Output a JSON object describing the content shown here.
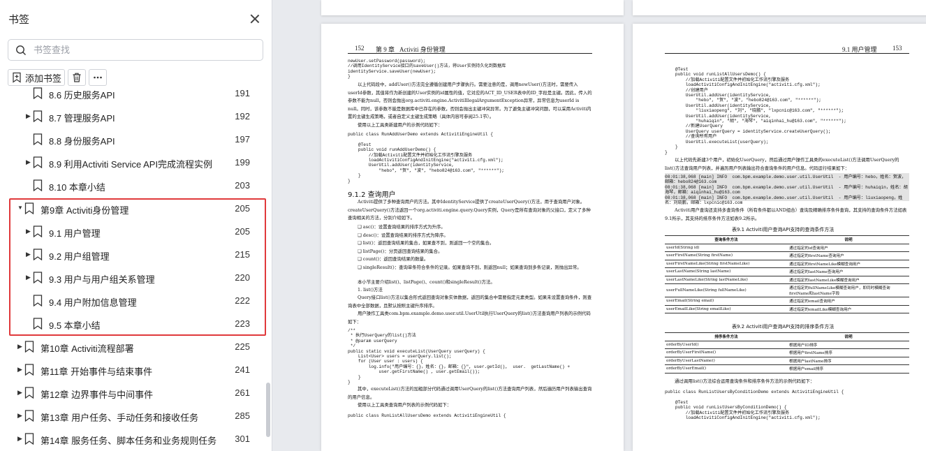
{
  "sidebar": {
    "title": "书签",
    "search_placeholder": "书签查找",
    "add_bookmark": "添加书签",
    "toc": [
      {
        "label": "8.6  历史服务API",
        "page": "191",
        "level": 1,
        "arrow": false
      },
      {
        "label": "8.7  管理服务API",
        "page": "192",
        "level": 1,
        "arrow": true
      },
      {
        "label": "8.8  身份服务API",
        "page": "197",
        "level": 1,
        "arrow": false
      },
      {
        "label": "8.9  利用Activiti Service API完成流程实例",
        "page": "199",
        "level": 1,
        "arrow": true
      },
      {
        "label": "8.10  本章小结",
        "page": "203",
        "level": 1,
        "arrow": false
      },
      {
        "label": "第9章  Activiti身份管理",
        "page": "205",
        "level": 0,
        "arrow": "down"
      },
      {
        "label": "9.1  用户管理",
        "page": "205",
        "level": 1,
        "arrow": true
      },
      {
        "label": "9.2  用户组管理",
        "page": "215",
        "level": 1,
        "arrow": true
      },
      {
        "label": "9.3  用户与用户组关系管理",
        "page": "220",
        "level": 1,
        "arrow": true
      },
      {
        "label": "9.4  用户附加信息管理",
        "page": "222",
        "level": 1,
        "arrow": false
      },
      {
        "label": "9.5  本章小结",
        "page": "223",
        "level": 1,
        "arrow": false
      },
      {
        "label": "第10章  Activiti流程部署",
        "page": "225",
        "level": 0,
        "arrow": true
      },
      {
        "label": "第11章  开始事件与结束事件",
        "page": "241",
        "level": 0,
        "arrow": true
      },
      {
        "label": "第12章  边界事件与中间事件",
        "page": "261",
        "level": 0,
        "arrow": true
      },
      {
        "label": "第13章  用户任务、手动任务和接收任务",
        "page": "285",
        "level": 0,
        "arrow": true
      },
      {
        "label": "第14章  服务任务、脚本任务和业务规则任务",
        "page": "301",
        "level": 0,
        "arrow": true
      }
    ]
  },
  "left_page": {
    "header_num": "152",
    "header_chapter": "第 9 章",
    "header_title": "Activiti 身份管理",
    "code1": "newUser.setPassword(password);\n//调用IdentityService接口的saveUser()方法，将User实例持久化到数据库\nidentityService.saveUser(newUser);\n}",
    "para1": "以上代码段中，addUser()方法完全遵循创建用户步骤执行。需要注意的是，调用newUser()方法时，需要传入userId参数，其值将作为新创建的User实例的id属性的值，它对应的ACT_ID_USER表中的ID_字段是主键。因此，传入的参数不能为null，否则会抛出org.activiti.engine.ActivitiIllegalArgumentException异常，异常信息为userId is null。同时，该参数不能是数据库中已存在的参数，否则会抛出主键冲突异常。为了避免主键冲突问题，可以采用Activiti内置的主键生成策略，或者自定义主键生成策略（具体内容可参阅25.1节）。",
    "para1b": "使用以上工具类新建用户的示例代码如下：",
    "code2": "public class RunAddUserDemo extends ActivitiEngineUtil {\n\n    @Test\n    public void runAddUserDemo() {\n        //加载Activiti配置文件并初始化工作流引擎及服务\n        loadActivitiConfigAndInitEngine(\"activiti.cfg.xml\");\n        UserUtil.addUser(identityService,\n            \"hebo\", \"贺\", \"波\", \"hebo824@163.com\", \"******\");\n    }\n}",
    "section_title": "9.1.2  查询用户",
    "para2": "Activiti提供了多种查询用户的方法。其中IdentityService提供了createUserQuery()方法，用于查询用户对象。createUserQuery()方法返回一个org.activiti.engine.query.Query实例，Query是所有查询对象的父接口，定义了多种查询相关的方法，分别介绍如下。",
    "bullets": [
      "❑ asc()：设置查询结果的排序方式为升序。",
      "❑ desc()：设置查询结果的排序方式为降序。",
      "❑ list()：返回查询结果的集合，如果查不到，则返回一个空的集合。",
      "❑ listPage()：分页返回查询结果的集合。",
      "❑ count()：返回查询结果的数量。",
      "❑ singleResult()：查询单条符合条件的记录。如果查询不到，则返回null；如果查询到多条记录，则抛出异常。"
    ],
    "para3": "本小节主要介绍list()、listPage()、count()和singleResult()方法。",
    "sub1": "1. list()方法",
    "para4": "Query接口list()方法以集合形式返回查询对象实体数据，返回的集合中需要指定元素类型。如果未设置查询条件，则查询表中全部数据，且默认按照主键升序排序。",
    "para5": "用户操作工具类com.bpm.example.demo.user.util.UserUtil执行UserQuery的list()方法查询用户列表的示例代码如下：",
    "code3": "/**\n * 执行UserQuery的list()方法\n * @param userQuery\n */\npublic static void executeList(UserQuery userQuery) {\n    List<User> users = userQuery.list();\n    for (User user : users) {\n        log.info(\"用户编号：{}，姓名：{}，邮箱：{}\", user.getId(),  user.  getLastName() +\n            user.getFirstName() , user.getEmail());\n    }\n}",
    "para6": "其中，executeList()方法的加粗部分代码通过调用UserQuery的list()方法查询用户列表，然后遍历用户列表输出查询的用户信息。",
    "para7": "使用以上工具类查询用户列表的示例代码如下：",
    "code4": "public class RunListAllUsersDemo extends ActivitiEngineUtil {"
  },
  "right_page": {
    "header_section": "9.1  用户管理",
    "header_num": "153",
    "code1": "    @Test\n    public void runListAllUsersDemo() {\n        //加载Activiti配置文件并初始化工作流引擎及服务\n        loadActivitiConfigAndInitEngine(\"activiti.cfg.xml\");\n        //创建用户\n        UserUtil.addUser(identityService,\n            \"hebo\", \"贺\", \"波\", \"hebo824@163.com\", \"******\");\n        UserUtil.addUser(identityService,\n            \"liuxiaopeng\", \"刘\", \"晓鹏\", \"lxpcnic@163.com\", \"******\");\n        UserUtil.addUser(identityService,\n            \"huhaiqin\", \"胡\", \"海琴\", \"aiqinhai_hu@163.com\", \"******\");\n        //新建UserQuery\n        UserQuery userQuery = identityService.createUserQuery();\n        //查询所有用户\n        UserUtil.executeList(userQuery);\n    }\n}",
    "para1": "以上代码先新建3个用户，初始化UserQuery，然后通过用户操作工具类的executeList()方法调用UserQuery的list()方法查询用户列表，并遍历用户列表输出符合查询条件的用户信息。代码运行结果如下：",
    "log": "08:01:38,068 [main] INFO  com.bpm.example.demo.user.util.UserUtil  - 用户编号：hebo，姓名：贺波，邮箱：hebo824@163.com\n08:01:38,068 [main] INFO  com.bpm.example.demo.user.util.UserUtil  - 用户编号：huhaiqin，姓名：胡海琴，邮箱：aiqinhai_hu@163.com\n08:01:38,068 [main] INFO  com.bpm.example.demo.user.util.UserUtil  - 用户编号：liuxiaopeng，姓名：刘晓鹏，邮箱：lxpcnic@163.com",
    "para2": "Activiti用户查询还支持多查询条件（所有条件都以AND组合）查询及精确排序条件查询，其支持的查询条件方法如表9.1所示，其支持的排序条件方法如表9.2所示。",
    "table1_caption": "表9.1   Activiti用户查询API支持的查询条件方法",
    "table1_headers": [
      "查询条件方法",
      "说明"
    ],
    "table1_rows": [
      [
        "userId(String id)",
        "通过指定的id查询用户"
      ],
      [
        "userFirstName(String firstName)",
        "通过指定的firstName查询用户"
      ],
      [
        "userFirstNameLike(String firstNameLike)",
        "通过指定的firstNameLike模糊查询用户"
      ],
      [
        "userLastName(String lastName)",
        "通过指定的lastName查询用户"
      ],
      [
        "userLastNameLike(String lastNameLike)",
        "通过指定的lastNameLike模糊查询用户"
      ],
      [
        "userFullNameLike(String fullNameLike)",
        "通过指定的fullNameLike模糊查询用户，即同时模糊查询firstName和lastName字段"
      ],
      [
        "userEmail(String email)",
        "通过指定的email查询用户"
      ],
      [
        "userEmailLike(String emailLike)",
        "通过指定的emailLike模糊查询用户"
      ]
    ],
    "table2_caption": "表9.2   Activiti用户查询API支持的排序条件方法",
    "table2_headers": [
      "排序条件方法",
      "说明"
    ],
    "table2_rows": [
      [
        "orderByUserId()",
        "根据用户ID排序"
      ],
      [
        "orderByUserFirstName()",
        "根据用户firstName排序"
      ],
      [
        "orderByUserLastName()",
        "根据用户lastName排序"
      ],
      [
        "orderByUserEmail()",
        "根据用户email排序"
      ]
    ],
    "para3": "通过调用list()方法综合运用查询条件和排序条件方法的示例代码如下：",
    "code2": "public class RunListUsersByConditionDemo extends ActivitiEngineUtil {\n\n    @Test\n    public void runListUsersByConditionDemo() {\n        //加载Activiti配置文件并初始化工作流引擎及服务\n        loadActivitiConfigAndInitEngine(\"activiti.cfg.xml\");"
  }
}
